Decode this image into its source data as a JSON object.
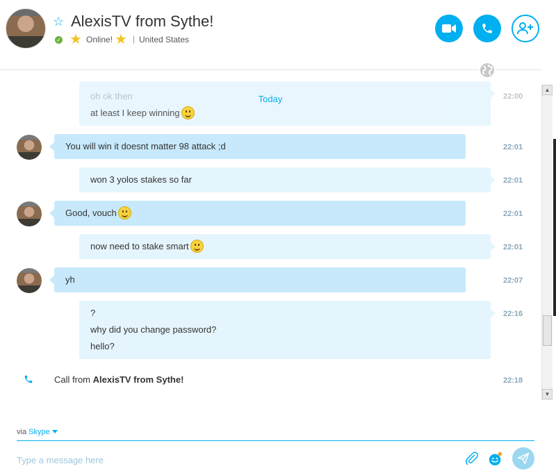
{
  "header": {
    "contact_name": "AlexisTV from Sythe!",
    "status_icon": "check-circle-icon",
    "mood_text": "Online!",
    "separator": "|",
    "location": "United States",
    "video_call_icon": "video-camera-icon",
    "audio_call_icon": "phone-icon",
    "add_people_icon": "add-person-icon",
    "accent_color": "#00aff0"
  },
  "conversation": {
    "day_label": "Today",
    "faded_message_1": "oh ok then",
    "faded_message_2": "at least I keep winning",
    "faded_time": "22:00",
    "messages": [
      {
        "direction": "incoming",
        "text": "You will win it doesnt matter 98 attack ;d",
        "time": "22:01"
      },
      {
        "direction": "outgoing",
        "text": "won 3 yolos stakes so far",
        "time": "22:01"
      },
      {
        "direction": "incoming",
        "text": "Good, vouch",
        "emoticon": "smile",
        "time": "22:01"
      },
      {
        "direction": "outgoing",
        "text": "now need to stake smart",
        "emoticon": "smile",
        "time": "22:01"
      },
      {
        "direction": "incoming",
        "text": "yh",
        "time": "22:07"
      },
      {
        "direction": "outgoing",
        "lines": [
          "?",
          "why did you change password?",
          "hello?"
        ],
        "time": "22:16"
      }
    ],
    "call": {
      "prefix": "Call from",
      "caller": "AlexisTV from Sythe!",
      "time": "22:18"
    }
  },
  "composer": {
    "via_label": "via",
    "via_service": "Skype",
    "placeholder": "Type a message here"
  }
}
